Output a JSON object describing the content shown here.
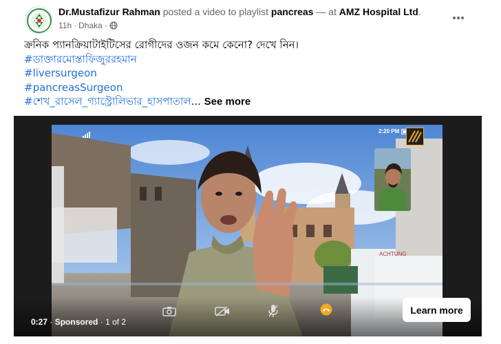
{
  "post": {
    "author": "Dr.Mustafizur Rahman",
    "action_text": " posted a video to playlist ",
    "playlist": "pancreas",
    "at_text": " — at ",
    "location": "AMZ Hospital Ltd",
    "period": ".",
    "time": "11h",
    "separator": "·",
    "place": "Dhaka",
    "separator2": "·",
    "audience_icon": "globe-icon"
  },
  "body": {
    "line1": "ক্রনিক প্যানক্রিয়াটাইটিসের রোগীদের ওজন কমে কেনো? দেখে নিন।",
    "hashtags": [
      "#ডাক্তারমোস্তাফিজুররহমান",
      "#liversurgeon",
      "#pancreasSurgeon",
      "#শেখ_রাসেল_গ্যাস্ট্রোলিভার_হাসপাতাল"
    ],
    "ellipsis": "...",
    "see_more": "See more"
  },
  "video": {
    "phone_time": "2:20 PM",
    "elapsed": "0:27",
    "dot1": "·",
    "sponsored": "Sponsored",
    "dot2": "·",
    "page_count": "1 of 2",
    "cta": "Learn more"
  },
  "colors": {
    "hashtag": "#216fdb",
    "end_call": "#f5a623"
  }
}
